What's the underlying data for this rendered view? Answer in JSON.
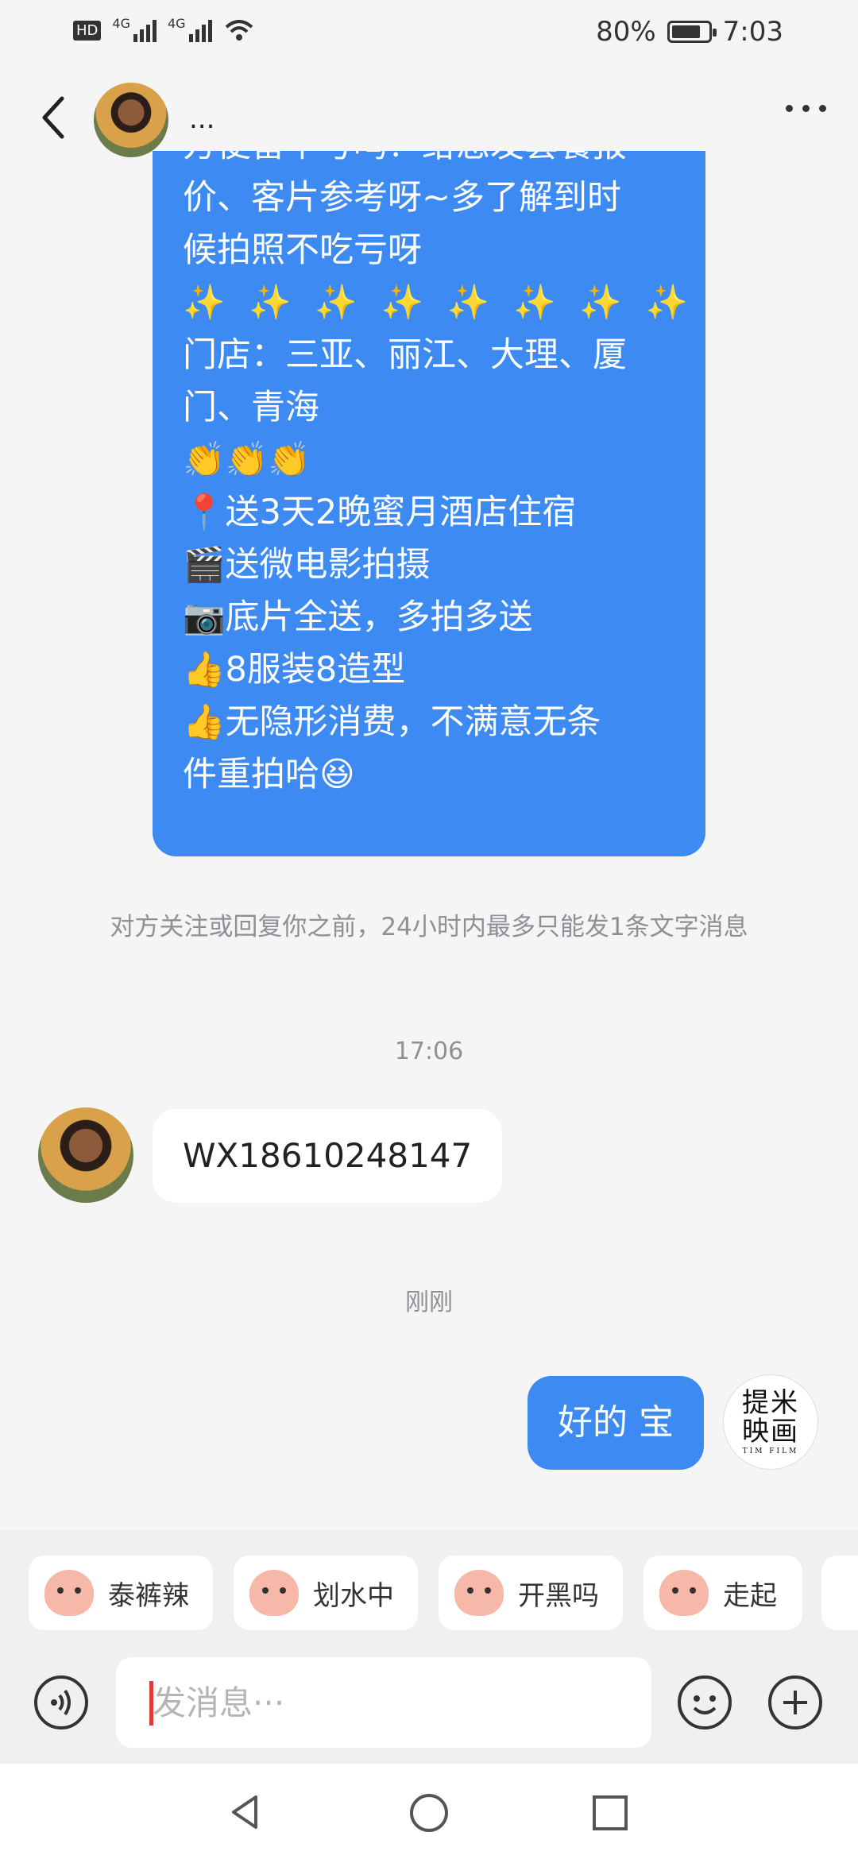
{
  "status_bar": {
    "network1": "4G",
    "network2": "4G",
    "hd": "HD",
    "battery_percent": "80%",
    "battery_level": 0.8,
    "time": "7:03"
  },
  "header": {
    "contact_name": "..."
  },
  "messages": {
    "incoming_long_lines": [
      "方便留个号吗？给您发套餐报",
      "价、客片参考呀~多了解到时",
      "候拍照不吃亏呀",
      "✨ ✨ ✨ ✨ ✨ ✨ ✨ ✨",
      "门店：三亚、丽江、大理、厦",
      "门、青海",
      "👏👏👏",
      "📍送3天2晚蜜月酒店住宿",
      "🎬送微电影拍摄",
      "📷底片全送，多拍多送",
      "👍8服装8造型",
      "👍无隐形消费，不满意无条",
      "件重拍哈😆"
    ],
    "notice": "对方关注或回复你之前，24小时内最多只能发1条文字消息",
    "time_1": "17:06",
    "outgoing_wx": "WX18610248147",
    "time_2": "刚刚",
    "reply": "好的 宝"
  },
  "logo": {
    "text": "提米映画",
    "sub": "TIM FILM"
  },
  "stickers": [
    {
      "label": "泰裤辣",
      "tag": "泰裤辣"
    },
    {
      "label": "划水中",
      "tag": ""
    },
    {
      "label": "开黑吗",
      "tag": ""
    },
    {
      "label": "走起",
      "tag": "走起"
    }
  ],
  "input": {
    "placeholder": "发消息···"
  },
  "icons": {
    "back": "chevron-left-icon",
    "more": "more-dots-icon",
    "voice": "voice-icon",
    "emoji": "emoji-icon",
    "plus": "plus-icon",
    "nav_back": "triangle-back-icon",
    "nav_home": "circle-home-icon",
    "nav_recent": "square-recent-icon"
  },
  "colors": {
    "accent_blue": "#3d8bf2",
    "background": "#f5f5f6"
  }
}
